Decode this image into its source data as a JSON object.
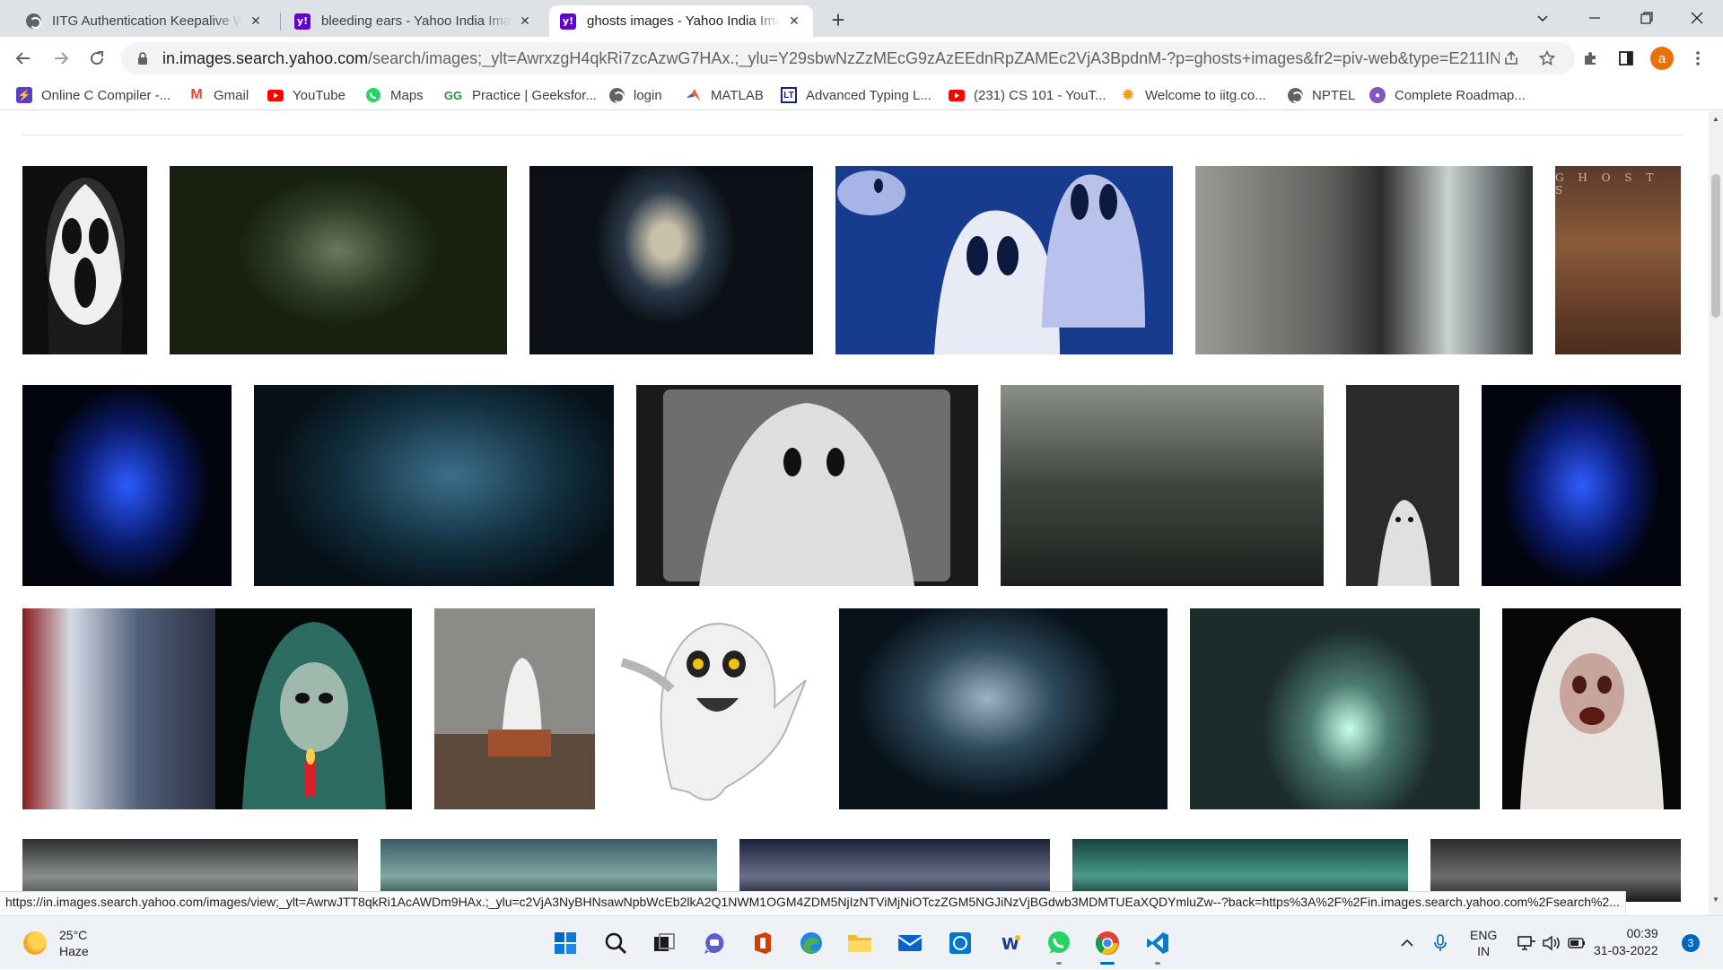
{
  "browser": {
    "tabs": [
      {
        "label": "IITG Authentication Keepalive Wi",
        "icon": "globe-icon",
        "active": false
      },
      {
        "label": "bleeding ears - Yahoo India Imag",
        "icon": "yahoo-icon",
        "active": false
      },
      {
        "label": "ghosts images - Yahoo India Imag",
        "icon": "yahoo-icon",
        "active": true
      }
    ],
    "new_tab": "+",
    "url_host": "in.images.search.yahoo.com",
    "url_rest": "/search/images;_ylt=AwrxzgH4qkRi7zcAzwG7HAx.;_ylu=Y29sbwNzZzMEcG9zAzEEdnRpZAMEc2VjA3BpdnM-?p=ghosts+images&fr2=piv-web&type=E211IN826G...",
    "profile_initial": "a",
    "accent_color": "#e8710a"
  },
  "bookmarks": [
    {
      "label": "Online C Compiler -...",
      "icon": "bolt-icon",
      "color": "#5b3cc4"
    },
    {
      "label": "Gmail",
      "icon": "gmail-icon",
      "color": "#ea4335"
    },
    {
      "label": "YouTube",
      "icon": "youtube-icon",
      "color": "#ff0000"
    },
    {
      "label": "Maps",
      "icon": "whatsapp-icon",
      "color": "#25d366"
    },
    {
      "label": "Practice | Geeksfor...",
      "icon": "gfg-icon",
      "color": "#2f8d46"
    },
    {
      "label": "login",
      "icon": "globe-icon",
      "color": "#5f6368"
    },
    {
      "label": "MATLAB",
      "icon": "matlab-icon",
      "color": "#e16737"
    },
    {
      "label": "Advanced Typing L...",
      "icon": "typing-icon",
      "color": "#1a237e"
    },
    {
      "label": "(231) CS 101 - YouT...",
      "icon": "youtube-icon",
      "color": "#ff0000"
    },
    {
      "label": "Welcome to iitg.co...",
      "icon": "iitg-icon",
      "color": "#f29c1f"
    },
    {
      "label": "NPTEL",
      "icon": "globe-icon",
      "color": "#5f6368"
    },
    {
      "label": "Complete Roadmap...",
      "icon": "avatar-icon",
      "color": "#7e57c2"
    }
  ],
  "results": {
    "ghosts_caption": "G H O S T S",
    "thumbnails": [
      {
        "name": "scream-mask",
        "bg": "radial-gradient(ellipse 35% 45% at 50% 45%, #e8e8e8 40%, #777 70%, #111 100%)"
      },
      {
        "name": "green-ghost-woman",
        "bg": "radial-gradient(ellipse 30% 40% at 50% 45%, #6a7a5a 0%, #2e3b26 60%, #18210f 100%)"
      },
      {
        "name": "ghostface-dark",
        "bg": "radial-gradient(ellipse 25% 45% at 48% 40%, #c9c0a8 20%, #2b3a4a 60%, #0b1016 100%)"
      },
      {
        "name": "cartoon-sheet-ghosts",
        "bg": "radial-gradient(ellipse 30% 60% at 45% 80%, #e6e8f5 40%, #8fa0d8 70%, #1a3a8a 100%)"
      },
      {
        "name": "hanging-ghost-girl",
        "bg": "linear-gradient(90deg, #9a9a96 0%, #5f5f5c 40%, #2d2d2b 55%, #c8d0d0 75%, #2b2f31 100%)"
      },
      {
        "name": "ghosts-tv-show",
        "bg": "linear-gradient(180deg, #5a3a2c 0%, #8c5a3a 40%, #4a2c1e 100%)"
      },
      {
        "name": "blue-ghost-hood",
        "bg": "radial-gradient(ellipse 40% 50% at 50% 50%, #2b5aff 0%, #0a1a6a 60%, #02040e 100%)"
      },
      {
        "name": "long-hair-ghost",
        "bg": "radial-gradient(ellipse 50% 60% at 55% 45%, #3c6f8c 0%, #12303f 60%, #061017 100%)"
      },
      {
        "name": "sheet-ghost-frame",
        "bg": "radial-gradient(ellipse 35% 55% at 50% 60%, #d8d8d8 35%, #8a8a8a 70%, #222 100%)"
      },
      {
        "name": "bridge-ghost-woman",
        "bg": "linear-gradient(180deg, #8a8f88 0%, #3f463f 50%, #1c201c 100%)"
      },
      {
        "name": "small-sheet-ghost",
        "bg": "radial-gradient(ellipse 35% 25% at 50% 80%, #d4d4d4 40%, #4b4b4b 80%, #2a2a2a 100%)"
      },
      {
        "name": "blue-ghost-lantern",
        "bg": "radial-gradient(ellipse 40% 50% at 50% 50%, #2f5cff 0%, #0b1a70 60%, #02040e 100%)"
      },
      {
        "name": "ghost-mother-window",
        "bg": "linear-gradient(90deg, #8a1c1c 0%, #d6dbe6 25%, #51607a 60%, #2c3142 100%)"
      },
      {
        "name": "green-ghost-candle",
        "bg": "radial-gradient(ellipse 40% 50% at 50% 45%, #5f9b8c 0%, #1d4a44 50%, #050b0a 100%)"
      },
      {
        "name": "sheet-ghost-field",
        "bg": "linear-gradient(180deg, #a7a6a4 0%, #6e6b66 55%, #6b4a35 80%, #3e2d22 100%)"
      },
      {
        "name": "cartoon-ghost",
        "bg": "radial-gradient(ellipse 40% 45% at 50% 45%, #f2f2f2 50%, #cfcfcf 65%, #ffffff 75%)"
      },
      {
        "name": "smoke-ghost-face",
        "bg": "radial-gradient(ellipse 40% 50% at 45% 45%, #9db3c5 0%, #2e4a5c 50%, #07121a 100%)"
      },
      {
        "name": "ghost-in-street",
        "bg": "radial-gradient(ellipse 30% 50% at 55% 60%, #c8ffe8 0%, #4c7a70 45%, #1b2c2a 100%)"
      },
      {
        "name": "bride-ghost",
        "bg": "radial-gradient(ellipse 40% 55% at 50% 55%, #e8e6e3 30%, #7b6a66 60%, #080606 100%)"
      },
      {
        "name": "row4-a",
        "bg": "linear-gradient(180deg, #2a2f31 0%, #8b8f8c 60%, #3b3f40 100%)"
      },
      {
        "name": "row4-b",
        "bg": "linear-gradient(180deg, #3b5c6a 0%, #7fa9a2 60%, #1d3034 100%)"
      },
      {
        "name": "row4-c",
        "bg": "linear-gradient(180deg, #1b2238 0%, #6a6f8a 60%, #0f1322 100%)"
      },
      {
        "name": "row4-d",
        "bg": "linear-gradient(180deg, #15423f 0%, #4c9b8c 60%, #0c1c1a 100%)"
      },
      {
        "name": "row4-e",
        "bg": "linear-gradient(180deg, #2b2c2c 0%, #6b6d70 60%, #1a1b1b 100%)"
      }
    ]
  },
  "status_url": "https://in.images.search.yahoo.com/images/view;_ylt=AwrwJTT8qkRi1AcAWDm9HAx.;_ylu=c2VjA3NyBHNsawNpbWcEb2lkA2Q1NWM1OGM4ZDM5NjIzNTViMjNiOTczZGM5NGJiNzVjBGdwb3MDMTUEaXQDYmluZw--?back=https%3A%2F%2Fin.images.search.yahoo.com%2Fsearch%2...",
  "taskbar": {
    "temperature": "25°C",
    "weather": "Haze",
    "lang_line1": "ENG",
    "lang_line2": "IN",
    "time": "00:39",
    "date": "31-03-2022",
    "notification_count": "3"
  }
}
